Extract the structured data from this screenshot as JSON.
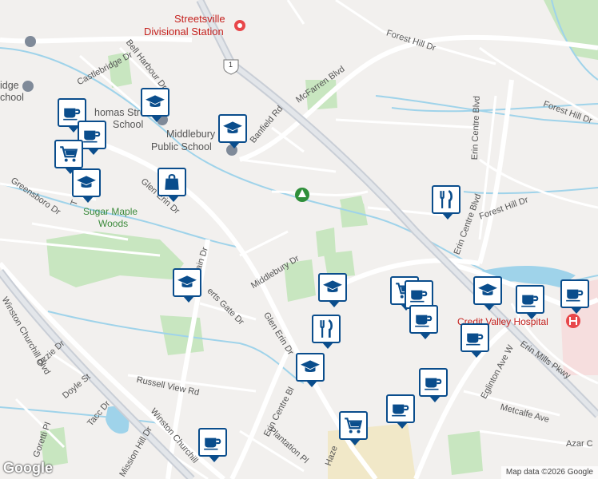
{
  "map": {
    "labels": {
      "streetsville_station_1": "Streetsville",
      "streetsville_station_2": "Divisional Station",
      "forest_hill_dr_top": "Forest Hill Dr",
      "forest_hill_dr_right": "Forest Hill Dr",
      "forest_hill_dr_mid": "Forest Hill Dr",
      "mcfarren_blvd": "McFarren Blvd",
      "castlebridge_dr": "Castlebridge Dr",
      "bell_harbour_dr": "Bell Harbour Dr",
      "thomas_street_school_1": "homas Street",
      "thomas_street_school_2": "School",
      "banfield_rd": "Banfield Rd",
      "middlebury_school_1": "Middlebury",
      "middlebury_school_2": "Public School",
      "ridge_school_1": "idge",
      "ridge_school_2": "chool",
      "greensboro_dr": "Greensboro Dr",
      "glen_erin_dr_upper": "Glen Erin Dr",
      "glen_erin_dr_mid": "Glen Erin Dr",
      "sugar_maple_woods_1": "Sugar Maple",
      "sugar_maple_woods_2": "Woods",
      "erin_centre_blvd_top": "Erin Centre Blvd",
      "erin_centre_blvd_right": "Erin Centre Blvd",
      "erin_centre_blvd_bottom": "Erin Centre Bl",
      "middlebury_dr": "Middlebury Dr",
      "winston_churchill_blvd_left": "Winston Churchill Blvd",
      "winston_churchill_blvd_bottom": "Winston Churchill",
      "roberts_gate_dr": "erts Gate Dr",
      "ozzie_dr": "Ozzie Dr",
      "doyle_st": "Doyle St",
      "russell_view_rd": "Russell View Rd",
      "tacc_dr": "Tacc Dr",
      "goretti_pl": "Goretti Pl",
      "mission_hill_dr": "Mission Hill Dr",
      "plantation_pl": "Plantation Pl",
      "eglinton_ave_w": "Eglinton Ave W",
      "erin_mills_pkwy": "Erin Mills Pkwy",
      "credit_valley_hospital": "Credit Valley Hospital",
      "metcalfe_ave": "Metcalfe Ave",
      "azar_ct": "Azar C",
      "hazel": "Haze",
      "ain_dr": "ain Dr",
      "highway_shield": "1",
      "t_street": "T"
    },
    "markers": [
      {
        "type": "school",
        "icon": "graduation-cap-icon"
      },
      {
        "type": "cafe",
        "icon": "coffee-cup-icon"
      },
      {
        "type": "cafe",
        "icon": "coffee-cup-icon"
      },
      {
        "type": "shopping",
        "icon": "shopping-cart-icon"
      },
      {
        "type": "school",
        "icon": "graduation-cap-icon"
      },
      {
        "type": "school",
        "icon": "graduation-cap-icon"
      },
      {
        "type": "shopping",
        "icon": "shopping-bag-icon"
      },
      {
        "type": "restaurant",
        "icon": "fork-knife-icon"
      },
      {
        "type": "school",
        "icon": "graduation-cap-icon"
      },
      {
        "type": "school",
        "icon": "graduation-cap-icon"
      },
      {
        "type": "restaurant",
        "icon": "fork-knife-icon"
      },
      {
        "type": "shopping",
        "icon": "shopping-cart-icon"
      },
      {
        "type": "cafe",
        "icon": "coffee-cup-icon"
      },
      {
        "type": "school",
        "icon": "graduation-cap-icon"
      },
      {
        "type": "cafe",
        "icon": "coffee-cup-icon"
      },
      {
        "type": "cafe",
        "icon": "coffee-cup-icon"
      },
      {
        "type": "cafe",
        "icon": "coffee-cup-icon"
      },
      {
        "type": "cafe",
        "icon": "coffee-cup-icon"
      },
      {
        "type": "cafe",
        "icon": "coffee-cup-icon"
      },
      {
        "type": "school",
        "icon": "graduation-cap-icon"
      },
      {
        "type": "cafe",
        "icon": "coffee-cup-icon"
      },
      {
        "type": "shopping",
        "icon": "shopping-cart-icon"
      },
      {
        "type": "cafe",
        "icon": "coffee-cup-icon"
      }
    ]
  },
  "attribution": {
    "logo": "Google",
    "map_data": "Map data ©2026 Google"
  },
  "colors": {
    "marker_border": "#0a4d8c",
    "park": "#c8e6c0",
    "water": "#9fd3ea",
    "major_road": "#c9ced6",
    "hospital": "#e8474a"
  }
}
